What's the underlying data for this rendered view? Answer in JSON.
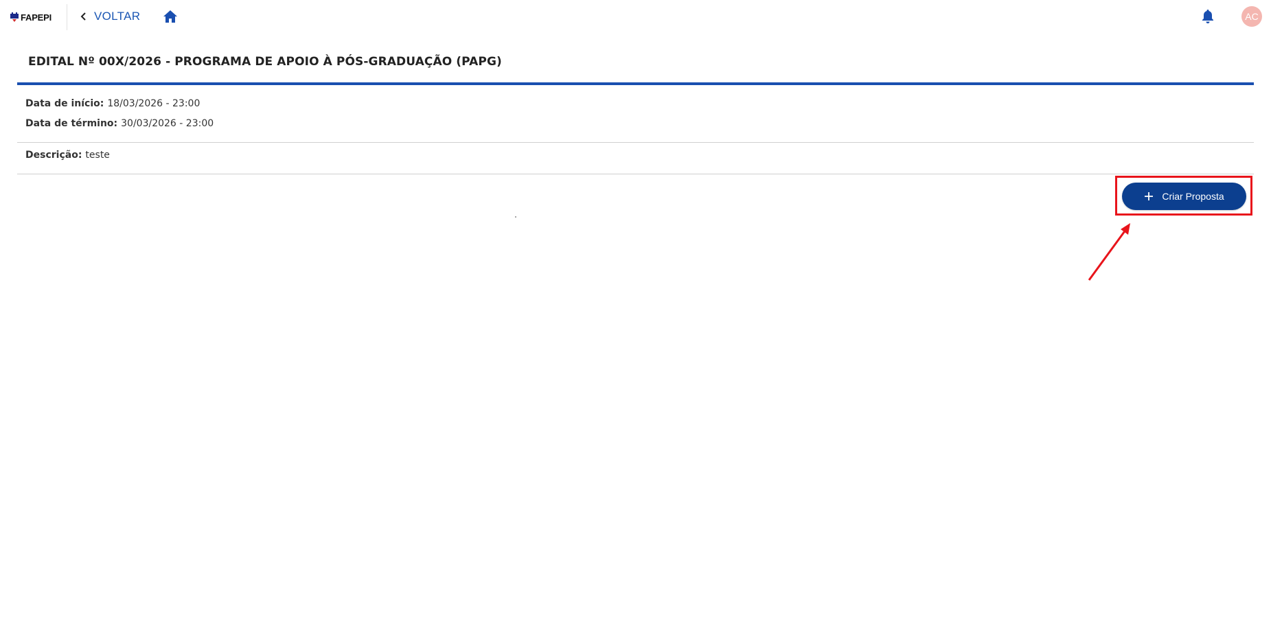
{
  "header": {
    "logo_text": "FAPEPI",
    "back_label": "VOLTAR",
    "avatar_initials": "AC"
  },
  "page": {
    "title": "EDITAL Nº 00X/2026 - PROGRAMA DE APOIO À PÓS-GRADUAÇÃO (PAPG)",
    "start_label": "Data de início:",
    "start_value": "18/03/2026 - 23:00",
    "end_label": "Data de término:",
    "end_value": "30/03/2026 - 23:00",
    "description_label": "Descrição:",
    "description_value": "teste"
  },
  "actions": {
    "create_label": "Criar Proposta"
  },
  "colors": {
    "primary": "#0c3f8f",
    "accent_link": "#1a56b3",
    "title_rule": "#1a4fb0",
    "annotation_red": "#e8141b",
    "avatar_bg": "#f4b6b0"
  },
  "icons": {
    "logo": "fapepi-logo-icon",
    "back": "chevron-left-icon",
    "home": "home-icon",
    "notifications": "bell-icon",
    "create": "plus-icon"
  }
}
